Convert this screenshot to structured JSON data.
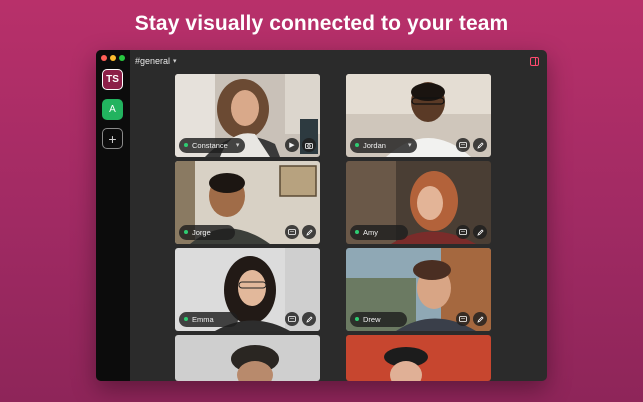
{
  "headline": "Stay visually connected to your team",
  "workspaces": [
    {
      "label": "TS",
      "color": "#8c1f48"
    },
    {
      "label": "A",
      "color": "#22b35f"
    },
    {
      "label": "+"
    }
  ],
  "channel": {
    "name": "#general",
    "chevron": "▾"
  },
  "participants": [
    {
      "name": "Constance",
      "icons": [
        "play-icon",
        "camera-icon"
      ],
      "has_menu": true
    },
    {
      "name": "Jordan",
      "icons": [
        "chat-icon",
        "pencil-icon"
      ],
      "has_menu": true
    },
    {
      "name": "Jorge",
      "icons": [
        "chat-icon",
        "pencil-icon"
      ]
    },
    {
      "name": "Amy",
      "icons": [
        "chat-icon",
        "pencil-icon"
      ]
    },
    {
      "name": "Emma",
      "icons": [
        "chat-icon",
        "pencil-icon"
      ]
    },
    {
      "name": "Drew",
      "icons": [
        "chat-icon",
        "pencil-icon"
      ]
    }
  ],
  "colors": {
    "background": "#a8306a",
    "window": "#2b2b2b",
    "sidebar": "#0c0c0c",
    "online": "#2ecc71",
    "accent": "#ff4a6e"
  }
}
